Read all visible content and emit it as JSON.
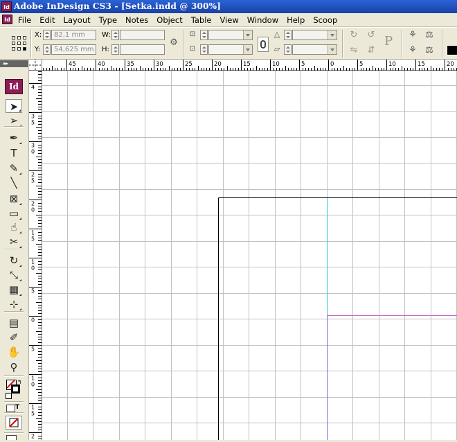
{
  "window": {
    "title": "Adobe InDesign CS3 - [Setka.indd @ 300%]",
    "app_icon": "Id",
    "doc_icon": "Id"
  },
  "menu": [
    "File",
    "Edit",
    "Layout",
    "Type",
    "Notes",
    "Object",
    "Table",
    "View",
    "Window",
    "Help",
    "Scoop"
  ],
  "control": {
    "x_label": "X:",
    "x_value": "82,1 mm",
    "y_label": "Y:",
    "y_value": "54,625 mm",
    "w_label": "W:",
    "w_value": "",
    "h_label": "H:",
    "h_value": "",
    "scale_x_value": "",
    "scale_y_value": "",
    "rotate_value": "",
    "shear_value": ""
  },
  "tools_panel": {
    "logo": "Id",
    "tools": [
      {
        "name": "selection-tool",
        "glyph": "➤"
      },
      {
        "name": "direct-selection-tool",
        "glyph": "➢"
      },
      {
        "name": "pen-tool",
        "glyph": "✒"
      },
      {
        "name": "type-tool",
        "glyph": "T"
      },
      {
        "name": "pencil-tool",
        "glyph": "✎"
      },
      {
        "name": "line-tool",
        "glyph": "╲"
      },
      {
        "name": "rectangle-frame-tool",
        "glyph": "⊠"
      },
      {
        "name": "rectangle-tool",
        "glyph": "▭"
      },
      {
        "name": "button-tool",
        "glyph": "☝"
      },
      {
        "name": "scissors-tool",
        "glyph": "✂"
      },
      {
        "name": "rotate-tool",
        "glyph": "↻"
      },
      {
        "name": "scale-tool",
        "glyph": "⤡"
      },
      {
        "name": "gradient-tool",
        "glyph": "▦"
      },
      {
        "name": "free-transform-tool",
        "glyph": "⊹"
      },
      {
        "name": "note-tool",
        "glyph": "▤"
      },
      {
        "name": "eyedropper-tool",
        "glyph": "✐"
      },
      {
        "name": "hand-tool",
        "glyph": "✋"
      },
      {
        "name": "zoom-tool",
        "glyph": "⚲"
      }
    ]
  },
  "ruler": {
    "horizontal": [
      "45",
      "40",
      "35",
      "30",
      "25",
      "20",
      "15",
      "10",
      "5",
      "0",
      "5",
      "10",
      "15",
      "20"
    ],
    "vertical": [
      "4",
      "3|5",
      "3|0",
      "2|5",
      "2|0",
      "1|5",
      "1|0",
      "5",
      "0",
      "5",
      "1|0",
      "1|5",
      "2"
    ]
  },
  "colors": {
    "accent": "#8a1d54",
    "grid": "#c0c0c0",
    "guide_cyan": "#33c9c9",
    "guide_magenta": "#cc66cc"
  }
}
